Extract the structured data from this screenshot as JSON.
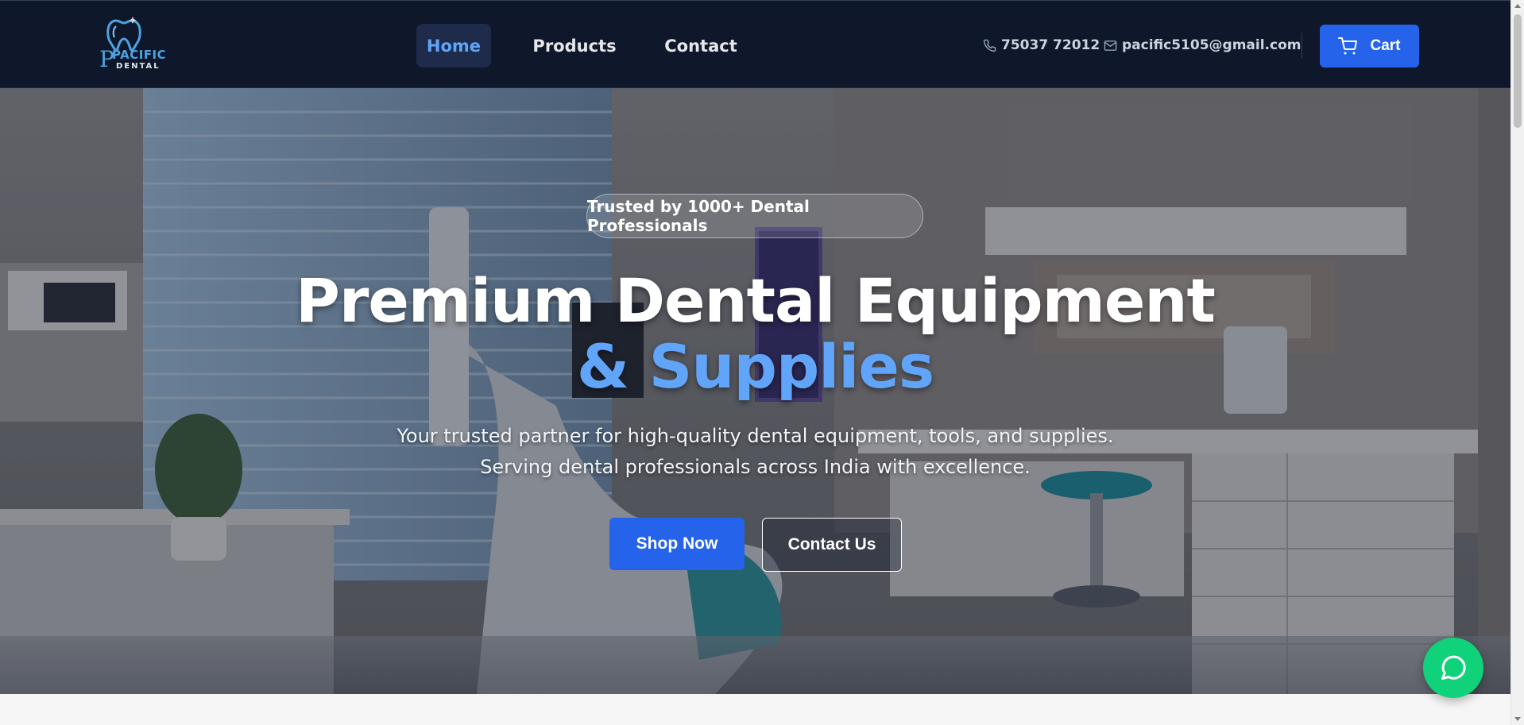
{
  "brand": {
    "logo_mark": "P",
    "name_line1": "PACIFIC",
    "name_line2": "DENTAL",
    "accent_color": "#4da3e0"
  },
  "nav": {
    "items": [
      {
        "label": "Home",
        "active": true
      },
      {
        "label": "Products",
        "active": false
      },
      {
        "label": "Contact",
        "active": false
      }
    ],
    "phone_icon": "phone-icon",
    "phone": "75037 72012",
    "email_icon": "mail-icon",
    "email": "pacific5105@gmail.com",
    "cart_icon": "cart-icon",
    "cart_label": "Cart"
  },
  "hero": {
    "badge": "Trusted by 1000+ Dental Professionals",
    "headline_line1": "Premium Dental Equipment",
    "headline_line2": "& Supplies",
    "subtitle_line1": "Your trusted partner for high-quality dental equipment, tools, and supplies.",
    "subtitle_line2": "Serving dental professionals across India with excellence.",
    "primary_cta": "Shop Now",
    "secondary_cta": "Contact Us"
  },
  "chat_widget": {
    "icon": "chat-bubble-icon",
    "color": "#10d27a"
  },
  "colors": {
    "navbar_bg": "#0f172a",
    "primary": "#2563eb",
    "highlight": "#60a5fa"
  }
}
